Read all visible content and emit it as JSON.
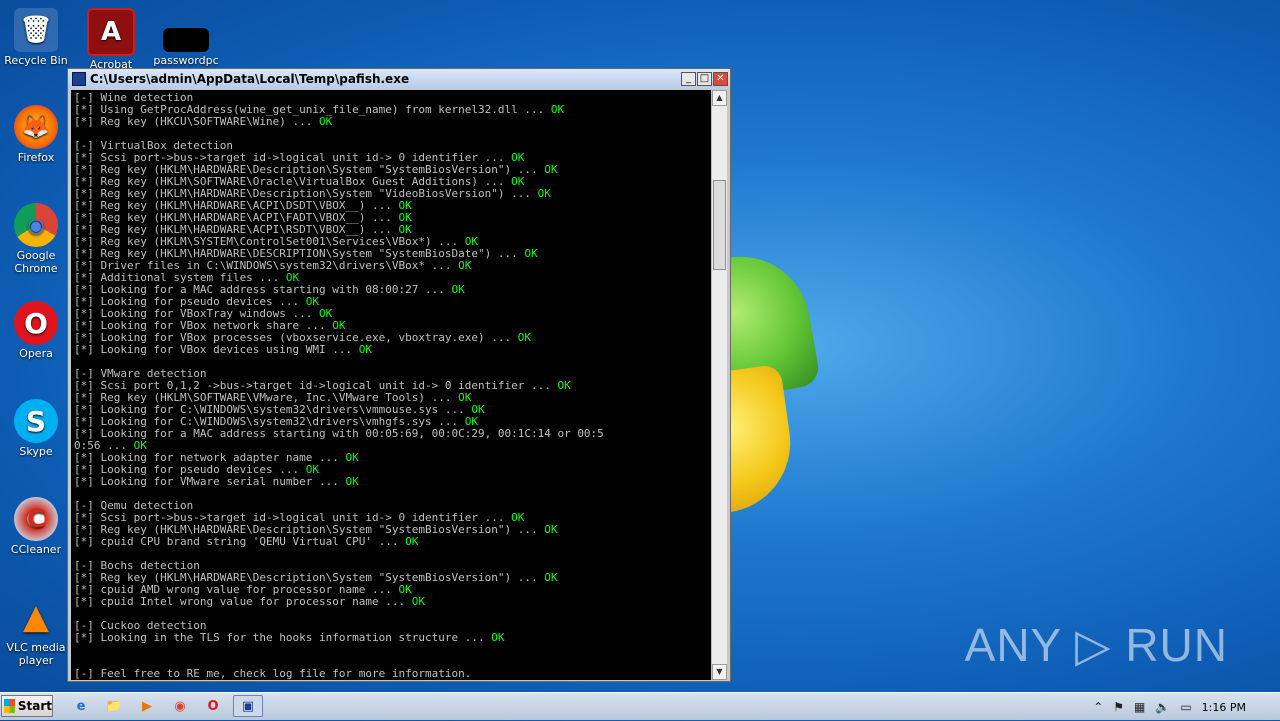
{
  "desktop": {
    "icons": [
      {
        "label": "Recycle Bin",
        "glyph": "🗑",
        "icon": "recycle-bin-icon"
      },
      {
        "label": "Acrobat",
        "glyph": "A",
        "icon": "acrobat-icon"
      },
      {
        "label": "passwordpc",
        "glyph": "",
        "icon": "file-icon"
      },
      {
        "label": "Firefox",
        "glyph": "🦊",
        "icon": "firefox-icon"
      },
      {
        "label": "Google Chrome",
        "glyph": "◉",
        "icon": "chrome-icon"
      },
      {
        "label": "Opera",
        "glyph": "O",
        "icon": "opera-icon"
      },
      {
        "label": "Skype",
        "glyph": "S",
        "icon": "skype-icon"
      },
      {
        "label": "CCleaner",
        "glyph": "C",
        "icon": "ccleaner-icon"
      },
      {
        "label": "VLC media player",
        "glyph": "▲",
        "icon": "vlc-icon"
      }
    ]
  },
  "window": {
    "title": "C:\\Users\\admin\\AppData\\Local\\Temp\\pafish.exe",
    "buttons": {
      "minimize": "_",
      "maximize": "□",
      "close": "✕"
    },
    "console_lines": [
      {
        "text": "[-] Wine detection",
        "ok": ""
      },
      {
        "text": "[*] Using GetProcAddress(wine_get_unix_file_name) from kernel32.dll ... ",
        "ok": "OK"
      },
      {
        "text": "[*] Reg key (HKCU\\SOFTWARE\\Wine) ... ",
        "ok": "OK"
      },
      {
        "text": "",
        "ok": ""
      },
      {
        "text": "[-] VirtualBox detection",
        "ok": ""
      },
      {
        "text": "[*] Scsi port->bus->target id->logical unit id-> 0 identifier ... ",
        "ok": "OK"
      },
      {
        "text": "[*] Reg key (HKLM\\HARDWARE\\Description\\System \"SystemBiosVersion\") ... ",
        "ok": "OK"
      },
      {
        "text": "[*] Reg key (HKLM\\SOFTWARE\\Oracle\\VirtualBox Guest Additions) ... ",
        "ok": "OK"
      },
      {
        "text": "[*] Reg key (HKLM\\HARDWARE\\Description\\System \"VideoBiosVersion\") ... ",
        "ok": "OK"
      },
      {
        "text": "[*] Reg key (HKLM\\HARDWARE\\ACPI\\DSDT\\VBOX__) ... ",
        "ok": "OK"
      },
      {
        "text": "[*] Reg key (HKLM\\HARDWARE\\ACPI\\FADT\\VBOX__) ... ",
        "ok": "OK"
      },
      {
        "text": "[*] Reg key (HKLM\\HARDWARE\\ACPI\\RSDT\\VBOX__) ... ",
        "ok": "OK"
      },
      {
        "text": "[*] Reg key (HKLM\\SYSTEM\\ControlSet001\\Services\\VBox*) ... ",
        "ok": "OK"
      },
      {
        "text": "[*] Reg key (HKLM\\HARDWARE\\DESCRIPTION\\System \"SystemBiosDate\") ... ",
        "ok": "OK"
      },
      {
        "text": "[*] Driver files in C:\\WINDOWS\\system32\\drivers\\VBox* ... ",
        "ok": "OK"
      },
      {
        "text": "[*] Additional system files ... ",
        "ok": "OK"
      },
      {
        "text": "[*] Looking for a MAC address starting with 08:00:27 ... ",
        "ok": "OK"
      },
      {
        "text": "[*] Looking for pseudo devices ... ",
        "ok": "OK"
      },
      {
        "text": "[*] Looking for VBoxTray windows ... ",
        "ok": "OK"
      },
      {
        "text": "[*] Looking for VBox network share ... ",
        "ok": "OK"
      },
      {
        "text": "[*] Looking for VBox processes (vboxservice.exe, vboxtray.exe) ... ",
        "ok": "OK"
      },
      {
        "text": "[*] Looking for VBox devices using WMI ... ",
        "ok": "OK"
      },
      {
        "text": "",
        "ok": ""
      },
      {
        "text": "[-] VMware detection",
        "ok": ""
      },
      {
        "text": "[*] Scsi port 0,1,2 ->bus->target id->logical unit id-> 0 identifier ... ",
        "ok": "OK"
      },
      {
        "text": "[*] Reg key (HKLM\\SOFTWARE\\VMware, Inc.\\VMware Tools) ... ",
        "ok": "OK"
      },
      {
        "text": "[*] Looking for C:\\WINDOWS\\system32\\drivers\\vmmouse.sys ... ",
        "ok": "OK"
      },
      {
        "text": "[*] Looking for C:\\WINDOWS\\system32\\drivers\\vmhgfs.sys ... ",
        "ok": "OK"
      },
      {
        "text": "[*] Looking for a MAC address starting with 00:05:69, 00:0C:29, 00:1C:14 or 00:5",
        "ok": ""
      },
      {
        "text": "0:56 ... ",
        "ok": "OK"
      },
      {
        "text": "[*] Looking for network adapter name ... ",
        "ok": "OK"
      },
      {
        "text": "[*] Looking for pseudo devices ... ",
        "ok": "OK"
      },
      {
        "text": "[*] Looking for VMware serial number ... ",
        "ok": "OK"
      },
      {
        "text": "",
        "ok": ""
      },
      {
        "text": "[-] Qemu detection",
        "ok": ""
      },
      {
        "text": "[*] Scsi port->bus->target id->logical unit id-> 0 identifier ... ",
        "ok": "OK"
      },
      {
        "text": "[*] Reg key (HKLM\\HARDWARE\\Description\\System \"SystemBiosVersion\") ... ",
        "ok": "OK"
      },
      {
        "text": "[*] cpuid CPU brand string 'QEMU Virtual CPU' ... ",
        "ok": "OK"
      },
      {
        "text": "",
        "ok": ""
      },
      {
        "text": "[-] Bochs detection",
        "ok": ""
      },
      {
        "text": "[*] Reg key (HKLM\\HARDWARE\\Description\\System \"SystemBiosVersion\") ... ",
        "ok": "OK"
      },
      {
        "text": "[*] cpuid AMD wrong value for processor name ... ",
        "ok": "OK"
      },
      {
        "text": "[*] cpuid Intel wrong value for processor name ... ",
        "ok": "OK"
      },
      {
        "text": "",
        "ok": ""
      },
      {
        "text": "[-] Cuckoo detection",
        "ok": ""
      },
      {
        "text": "[*] Looking in the TLS for the hooks information structure ... ",
        "ok": "OK"
      },
      {
        "text": "",
        "ok": ""
      },
      {
        "text": "",
        "ok": ""
      },
      {
        "text": "[-] Feel free to RE me, check log file for more information.",
        "ok": ""
      }
    ]
  },
  "taskbar": {
    "start_label": "Start",
    "apps": [
      {
        "name": "ie",
        "glyph": "e"
      },
      {
        "name": "explorer",
        "glyph": "📁"
      },
      {
        "name": "media",
        "glyph": "▶"
      },
      {
        "name": "chrome",
        "glyph": "◉"
      },
      {
        "name": "opera",
        "glyph": "O"
      },
      {
        "name": "pafish",
        "glyph": "▣"
      }
    ],
    "tray_icons": [
      "chevron-up",
      "flag",
      "network",
      "volume",
      "action-center"
    ],
    "clock": "1:16 PM"
  },
  "watermark": "ANY ▷ RUN"
}
